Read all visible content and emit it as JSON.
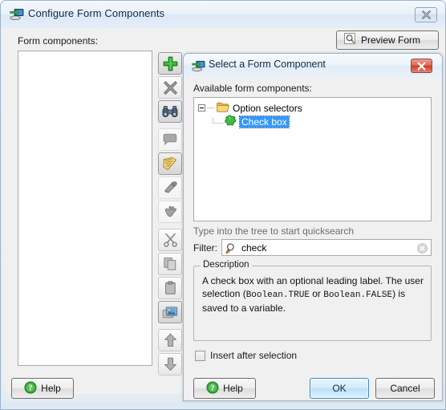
{
  "outer_window": {
    "title": "Configure Form Components",
    "title_icon": "form-designer-icon",
    "close_label": "✕",
    "form_components_label": "Form components:",
    "preview_button": {
      "label": "Preview Form",
      "icon": "magnifier-icon"
    },
    "help_button": {
      "label": "Help",
      "icon": "help-question-icon"
    },
    "toolbar": [
      {
        "name": "add",
        "icon": "green-plus-icon",
        "state": "enabled"
      },
      {
        "name": "delete",
        "icon": "gray-x-icon",
        "state": "enabled"
      },
      {
        "name": "find",
        "icon": "binoculars-icon",
        "state": "enabled"
      },
      {
        "name": "comment",
        "icon": "speech-bubble-icon",
        "state": "disabled"
      },
      {
        "name": "edit-note",
        "icon": "yellow-notepad-icon",
        "state": "enabled"
      },
      {
        "name": "validate",
        "icon": "gray-tool-icon",
        "state": "disabled"
      },
      {
        "name": "grab",
        "icon": "gray-hand-icon",
        "state": "disabled"
      },
      {
        "name": "cut",
        "icon": "scissors-icon",
        "state": "enabled"
      },
      {
        "name": "copy",
        "icon": "copy-pages-icon",
        "state": "enabled"
      },
      {
        "name": "paste",
        "icon": "clipboard-icon",
        "state": "enabled"
      },
      {
        "name": "properties",
        "icon": "image-cards-icon",
        "state": "selected"
      },
      {
        "name": "move-up",
        "icon": "arrow-up-icon",
        "state": "enabled"
      },
      {
        "name": "move-down",
        "icon": "arrow-down-icon",
        "state": "enabled"
      }
    ]
  },
  "inner_dialog": {
    "title": "Select a Form Component",
    "title_icon": "form-designer-icon",
    "close_label": "✕",
    "available_label": "Available form components:",
    "tree": {
      "root": {
        "label": "Option selectors",
        "icon": "folder-open-icon",
        "expanded": true
      },
      "child": {
        "label": "Check box",
        "icon": "green-puzzle-icon",
        "selected": true
      }
    },
    "quicksearch_hint": "Type into the tree to start quicksearch",
    "filter": {
      "label": "Filter:",
      "value": "check",
      "placeholder": "",
      "search_icon": "magnifier-icon",
      "clear_icon": "clear-circle-icon"
    },
    "description": {
      "legend": "Description",
      "part1": "A check box with an optional leading label. The user selection (",
      "code1": "Boolean.TRUE",
      "part2": " or ",
      "code2": "Boolean.FALSE",
      "part3": ") is saved to a variable."
    },
    "insert_after": {
      "label": "Insert after selection",
      "checked": false
    },
    "buttons": {
      "help": "Help",
      "ok": "OK",
      "cancel": "Cancel"
    }
  },
  "colors": {
    "accent_selection": "#3399ff",
    "window_frame": "#9bb4cc",
    "dialog_background": "#f0f0f0",
    "close_red": "#c9422c",
    "ok_focus_blue": "#3f88c5"
  }
}
